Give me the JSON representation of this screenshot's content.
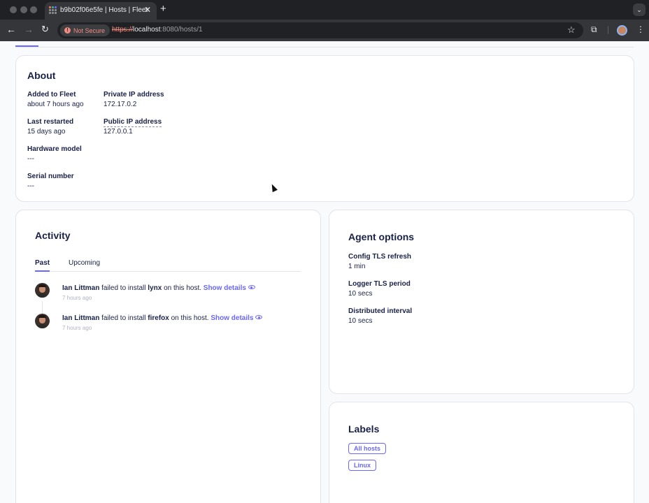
{
  "browser": {
    "tab_title": "b9b02f06e5fe | Hosts | Fleet",
    "security_label": "Not Secure",
    "url_scheme": "https://",
    "url_host": "localhost",
    "url_path": ":8080/hosts/1"
  },
  "about": {
    "title": "About",
    "fields": [
      {
        "label": "Added to Fleet",
        "value": "about 7 hours ago"
      },
      {
        "label": "Private IP address",
        "value": "172.17.0.2"
      },
      {
        "label": "Last restarted",
        "value": "15 days ago"
      },
      {
        "label": "Public IP address",
        "value": "127.0.0.1"
      },
      {
        "label": "Hardware model",
        "value": "---"
      },
      {
        "label": "Serial number",
        "value": "---"
      }
    ]
  },
  "activity": {
    "title": "Activity",
    "tabs": [
      "Past",
      "Upcoming"
    ],
    "items": [
      {
        "actor": "Ian Littman",
        "prefix": "failed to install",
        "software": "lynx",
        "suffix": "on this host.",
        "link": "Show details",
        "time": "7 hours ago"
      },
      {
        "actor": "Ian Littman",
        "prefix": "failed to install",
        "software": "firefox",
        "suffix": "on this host.",
        "link": "Show details",
        "time": "7 hours ago"
      }
    ]
  },
  "agent_options": {
    "title": "Agent options",
    "fields": [
      {
        "label": "Config TLS refresh",
        "value": "1 min"
      },
      {
        "label": "Logger TLS period",
        "value": "10 secs"
      },
      {
        "label": "Distributed interval",
        "value": "10 secs"
      }
    ]
  },
  "labels": {
    "title": "Labels",
    "items": [
      "All hosts",
      "Linux"
    ]
  }
}
